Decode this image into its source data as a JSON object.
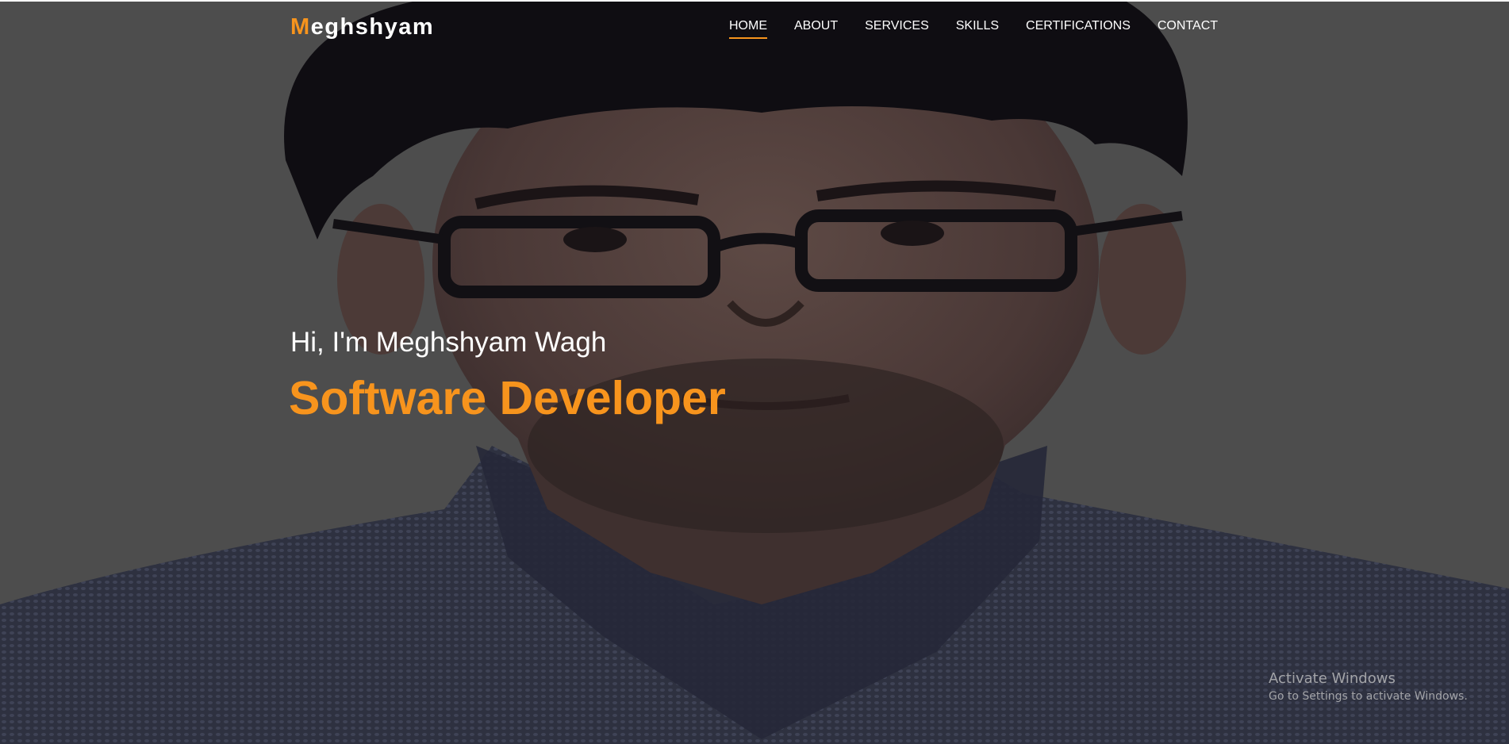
{
  "brand": {
    "logo_initial": "M",
    "logo_rest": "eghshyam"
  },
  "nav": {
    "items": [
      {
        "label": "HOME",
        "active": true
      },
      {
        "label": "ABOUT",
        "active": false
      },
      {
        "label": "SERVICES",
        "active": false
      },
      {
        "label": "SKILLS",
        "active": false
      },
      {
        "label": "CERTIFICATIONS",
        "active": false
      },
      {
        "label": "CONTACT",
        "active": false
      }
    ]
  },
  "hero": {
    "greeting": "Hi, I'm Meghshyam Wagh",
    "role": "Software Developer"
  },
  "watermark": {
    "title": "Activate Windows",
    "subtitle": "Go to Settings to activate Windows."
  },
  "colors": {
    "accent": "#f7941d",
    "text": "#ffffff",
    "background": "#4d4d4d"
  }
}
